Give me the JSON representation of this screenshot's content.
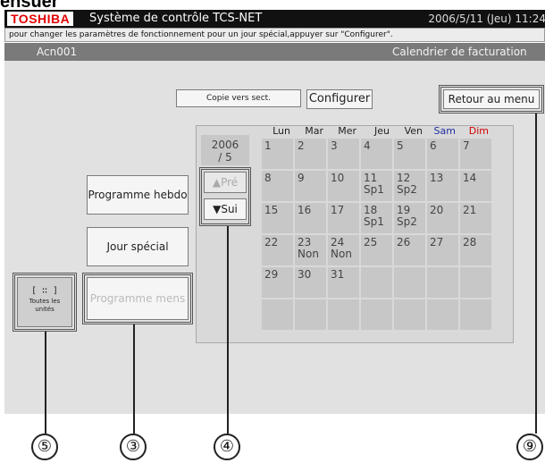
{
  "page_top_cut_text": "ensuer",
  "header": {
    "logo": "TOSHIBA",
    "title": "Système de contrôle TCS-NET",
    "datetime": "2006/5/11 (Jeu) 11:24"
  },
  "instruction": "pour changer les paramètres de fonctionnement pour un jour spécial,appuyer sur \"Configurer\".",
  "subheader": {
    "area_name": "Acn001",
    "screen_name": "Calendrier de facturation"
  },
  "buttons": {
    "copy": "Copie vers sect.",
    "configure": "Configurer",
    "back": "Retour au menu",
    "weekly": "Programme hebdo",
    "special": "Jour spécial",
    "monthly": "Programme mens",
    "all_units_l1": "Toutes les",
    "all_units_l2": "unités",
    "all_units_icon": "[ ∷ ]",
    "prev": "▲Pré",
    "next": "▼Sui"
  },
  "calendar": {
    "year": "2006",
    "month": "/ 5",
    "weekdays": [
      "Lun",
      "Mar",
      "Mer",
      "Jeu",
      "Ven",
      "Sam",
      "Dim"
    ],
    "weekday_colors": {
      "Sam": "#1f2fa0",
      "Dim": "#d40000"
    },
    "weeks": [
      [
        {
          "d": "1",
          "s": ""
        },
        {
          "d": "2",
          "s": ""
        },
        {
          "d": "3",
          "s": ""
        },
        {
          "d": "4",
          "s": ""
        },
        {
          "d": "5",
          "s": ""
        },
        {
          "d": "6",
          "s": ""
        },
        {
          "d": "7",
          "s": ""
        }
      ],
      [
        {
          "d": "8",
          "s": ""
        },
        {
          "d": "9",
          "s": ""
        },
        {
          "d": "10",
          "s": ""
        },
        {
          "d": "11",
          "s": "Sp1"
        },
        {
          "d": "12",
          "s": "Sp2"
        },
        {
          "d": "13",
          "s": ""
        },
        {
          "d": "14",
          "s": ""
        }
      ],
      [
        {
          "d": "15",
          "s": ""
        },
        {
          "d": "16",
          "s": ""
        },
        {
          "d": "17",
          "s": ""
        },
        {
          "d": "18",
          "s": "Sp1"
        },
        {
          "d": "19",
          "s": "Sp2"
        },
        {
          "d": "20",
          "s": ""
        },
        {
          "d": "21",
          "s": ""
        }
      ],
      [
        {
          "d": "22",
          "s": ""
        },
        {
          "d": "23",
          "s": "Non"
        },
        {
          "d": "24",
          "s": "Non"
        },
        {
          "d": "25",
          "s": ""
        },
        {
          "d": "26",
          "s": ""
        },
        {
          "d": "27",
          "s": ""
        },
        {
          "d": "28",
          "s": ""
        }
      ],
      [
        {
          "d": "29",
          "s": ""
        },
        {
          "d": "30",
          "s": ""
        },
        {
          "d": "31",
          "s": ""
        },
        {
          "d": "",
          "s": ""
        },
        {
          "d": "",
          "s": ""
        },
        {
          "d": "",
          "s": ""
        },
        {
          "d": "",
          "s": ""
        }
      ],
      [
        {
          "d": "",
          "s": ""
        },
        {
          "d": "",
          "s": ""
        },
        {
          "d": "",
          "s": ""
        },
        {
          "d": "",
          "s": ""
        },
        {
          "d": "",
          "s": ""
        },
        {
          "d": "",
          "s": ""
        },
        {
          "d": "",
          "s": ""
        }
      ]
    ]
  },
  "callouts": [
    "⑤",
    "③",
    "④",
    "⑨"
  ]
}
